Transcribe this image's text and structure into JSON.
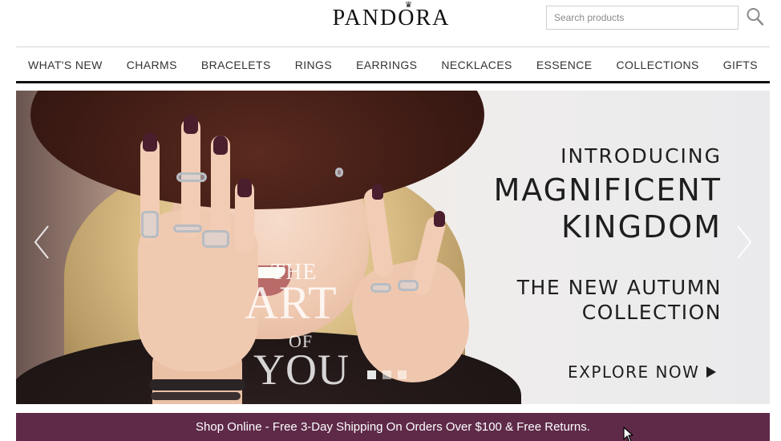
{
  "header": {
    "logo_text": "PANDORA",
    "search_placeholder": "Search products",
    "search_icon": "magnifying-glass"
  },
  "nav": {
    "items": [
      {
        "label": "WHAT'S NEW"
      },
      {
        "label": "CHARMS"
      },
      {
        "label": "BRACELETS"
      },
      {
        "label": "RINGS"
      },
      {
        "label": "EARRINGS"
      },
      {
        "label": "NECKLACES"
      },
      {
        "label": "ESSENCE"
      },
      {
        "label": "COLLECTIONS"
      },
      {
        "label": "GIFTS"
      }
    ]
  },
  "hero": {
    "intro": "INTRODUCING",
    "title_line1": "MAGNIFICENT",
    "title_line2": "KINGDOM",
    "subtitle_line1": "THE NEW AUTUMN",
    "subtitle_line2": "COLLECTION",
    "cta_label": "EXPLORE NOW",
    "overlay_line1": "THE",
    "overlay_line2": "ART",
    "overlay_line3": "OF",
    "overlay_line4": "YOU",
    "prev_icon": "chevron-left",
    "next_icon": "chevron-right",
    "carousel_slides": 3,
    "active_slide": 1
  },
  "promo": {
    "text": "Shop Online - Free 3-Day Shipping On Orders Over $100 & Free Returns."
  },
  "colors": {
    "promo_background": "#5e2a48",
    "nav_rule": "#111111",
    "nail_polish": "#4a1e2c"
  }
}
